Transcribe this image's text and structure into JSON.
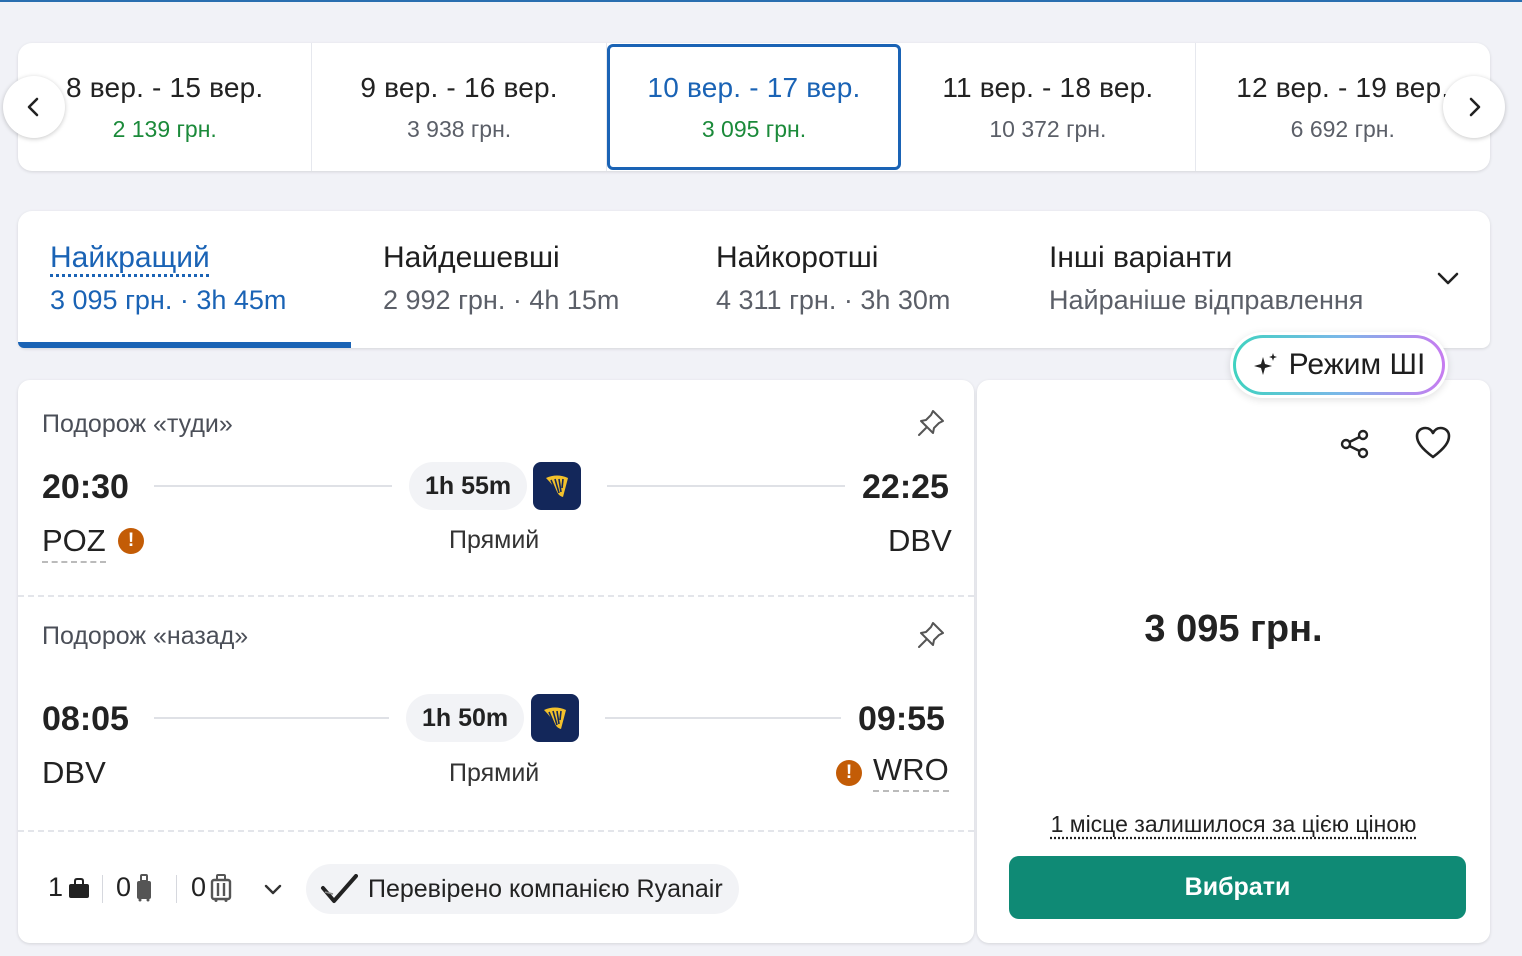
{
  "date_strip": {
    "cells": [
      {
        "range": "8 вер. - 15 вер.",
        "price": "2 139 грн."
      },
      {
        "range": "9 вер. - 16 вер.",
        "price": "3 938 грн."
      },
      {
        "range": "10 вер. - 17 вер.",
        "price": "3 095 грн."
      },
      {
        "range": "11 вер. - 18 вер.",
        "price": "10 372 грн."
      },
      {
        "range": "12 вер. - 19 вер.",
        "price": "6 692 грн."
      }
    ],
    "prev_icon": "chevron-left-icon",
    "next_icon": "chevron-right-icon"
  },
  "sort_tabs": [
    {
      "title": "Найкращий",
      "subtitle": "3 095 грн. · 3h 45m"
    },
    {
      "title": "Найдешевші",
      "subtitle": "2 992 грн. · 4h 15m"
    },
    {
      "title": "Найкоротші",
      "subtitle": "4 311 грн. · 3h 30m"
    },
    {
      "title": "Інші варіанти",
      "subtitle": "Найраніше відправлення"
    }
  ],
  "ai_mode": {
    "label": "Режим ШІ",
    "icon": "sparkle-icon"
  },
  "outbound": {
    "label": "Подорож «туди»",
    "depart_time": "20:30",
    "arrive_time": "22:25",
    "from": "POZ",
    "to": "DBV",
    "duration": "1h 55m",
    "stops": "Прямий"
  },
  "return": {
    "label": "Подорож «назад»",
    "depart_time": "08:05",
    "arrive_time": "09:55",
    "from": "DBV",
    "to": "WRO",
    "duration": "1h 50m",
    "stops": "Прямий"
  },
  "warning_glyph": "!",
  "baggage": {
    "personal_item": "1",
    "carry_on": "0",
    "checked": "0"
  },
  "verified_label": "Перевірено компанією Ryanair",
  "price_panel": {
    "price": "3 095 грн.",
    "seats_left": "1 місце залишилося за цією ціною",
    "select_label": "Вибрати"
  },
  "colors": {
    "accent_blue": "#1a63b5",
    "cheap_green": "#1b8a3a",
    "select_green": "#0f8a75",
    "warning_orange": "#c35c06",
    "ryanair_navy": "#13275a"
  }
}
